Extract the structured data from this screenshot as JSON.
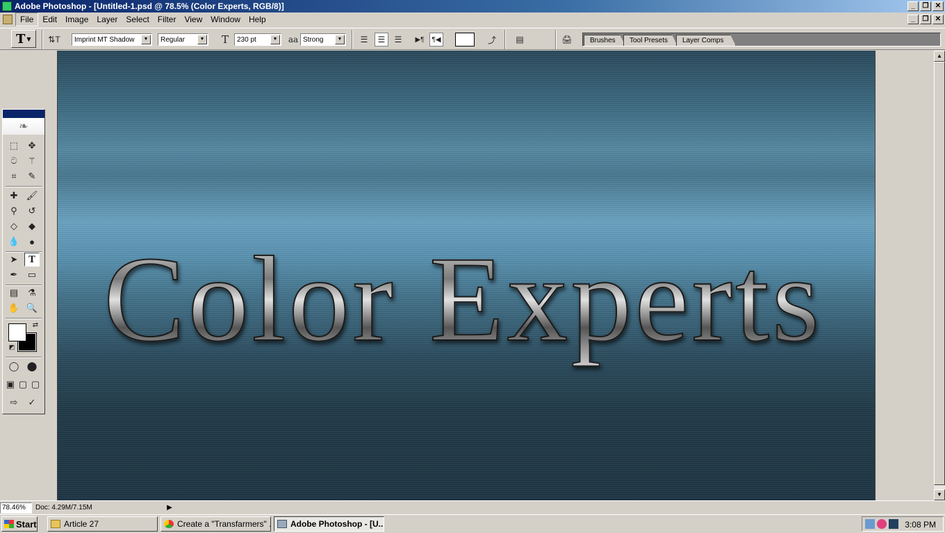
{
  "window": {
    "title": "Adobe Photoshop - [Untitled-1.psd @ 78.5% (Color Experts, RGB/8)]",
    "controls": [
      "_",
      "❐",
      "✕"
    ]
  },
  "menu": [
    "File",
    "Edit",
    "Image",
    "Layer",
    "Select",
    "Filter",
    "View",
    "Window",
    "Help"
  ],
  "options": {
    "tool_glyph": "T",
    "font_family": "Imprint MT Shadow",
    "font_style": "Regular",
    "font_size": "230 pt",
    "antialias_glyph": "aa",
    "antialias": "Strong",
    "text_color": "#ffffff"
  },
  "palette_well": {
    "tabs": [
      "Brushes",
      "Tool Presets",
      "Layer Comps"
    ]
  },
  "canvas": {
    "text": "Color Experts"
  },
  "status": {
    "zoom": "78.46%",
    "doc": "Doc: 4.29M/7.15M",
    "arrow": "▶"
  },
  "taskbar": {
    "start": "Start",
    "items": [
      {
        "label": "Article 27",
        "icon": "folder-icon"
      },
      {
        "label": "Create a \"Transfarmers\" ...",
        "icon": "chrome-icon"
      },
      {
        "label": "Adobe Photoshop - [U...",
        "icon": "photoshop-icon"
      }
    ],
    "clock": "3:08 PM"
  },
  "colors": {
    "foreground": "#ffffff",
    "background": "#000000",
    "titlebar": "#0a246a"
  }
}
